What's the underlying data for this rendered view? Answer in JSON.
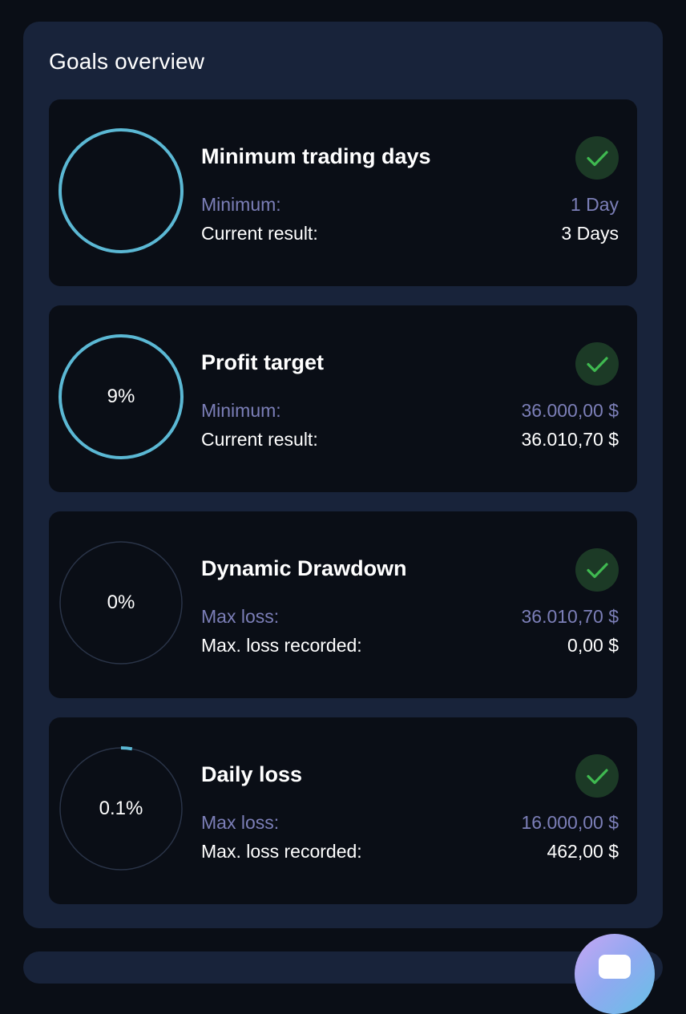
{
  "panel": {
    "title": "Goals overview"
  },
  "colors": {
    "ring_active": "#5bb8d4",
    "ring_track": "#2a3448",
    "check_bg": "#1c3a26",
    "check_mark": "#3fb950",
    "label_muted": "#7c7fb8"
  },
  "goals": [
    {
      "title": "Minimum trading days",
      "ring_label": "",
      "progress": 1.0,
      "status": "check-icon",
      "requirement_label": "Minimum:",
      "requirement_value": "1 Day",
      "result_label": "Current result:",
      "result_value": "3 Days"
    },
    {
      "title": "Profit target",
      "ring_label": "9%",
      "progress": 1.0,
      "status": "check-icon",
      "requirement_label": "Minimum:",
      "requirement_value": "36.000,00 $",
      "result_label": "Current result:",
      "result_value": "36.010,70 $"
    },
    {
      "title": "Dynamic Drawdown",
      "ring_label": "0%",
      "progress": 0.0,
      "status": "check-icon",
      "requirement_label": "Max loss:",
      "requirement_value": "36.010,70 $",
      "result_label": "Max. loss recorded:",
      "result_value": "0,00 $"
    },
    {
      "title": "Daily loss",
      "ring_label": "0.1%",
      "progress": 0.029,
      "status": "check-icon",
      "requirement_label": "Max loss:",
      "requirement_value": "16.000,00 $",
      "result_label": "Max. loss recorded:",
      "result_value": "462,00 $"
    }
  ],
  "fab": {
    "icon": "chat-icon"
  }
}
